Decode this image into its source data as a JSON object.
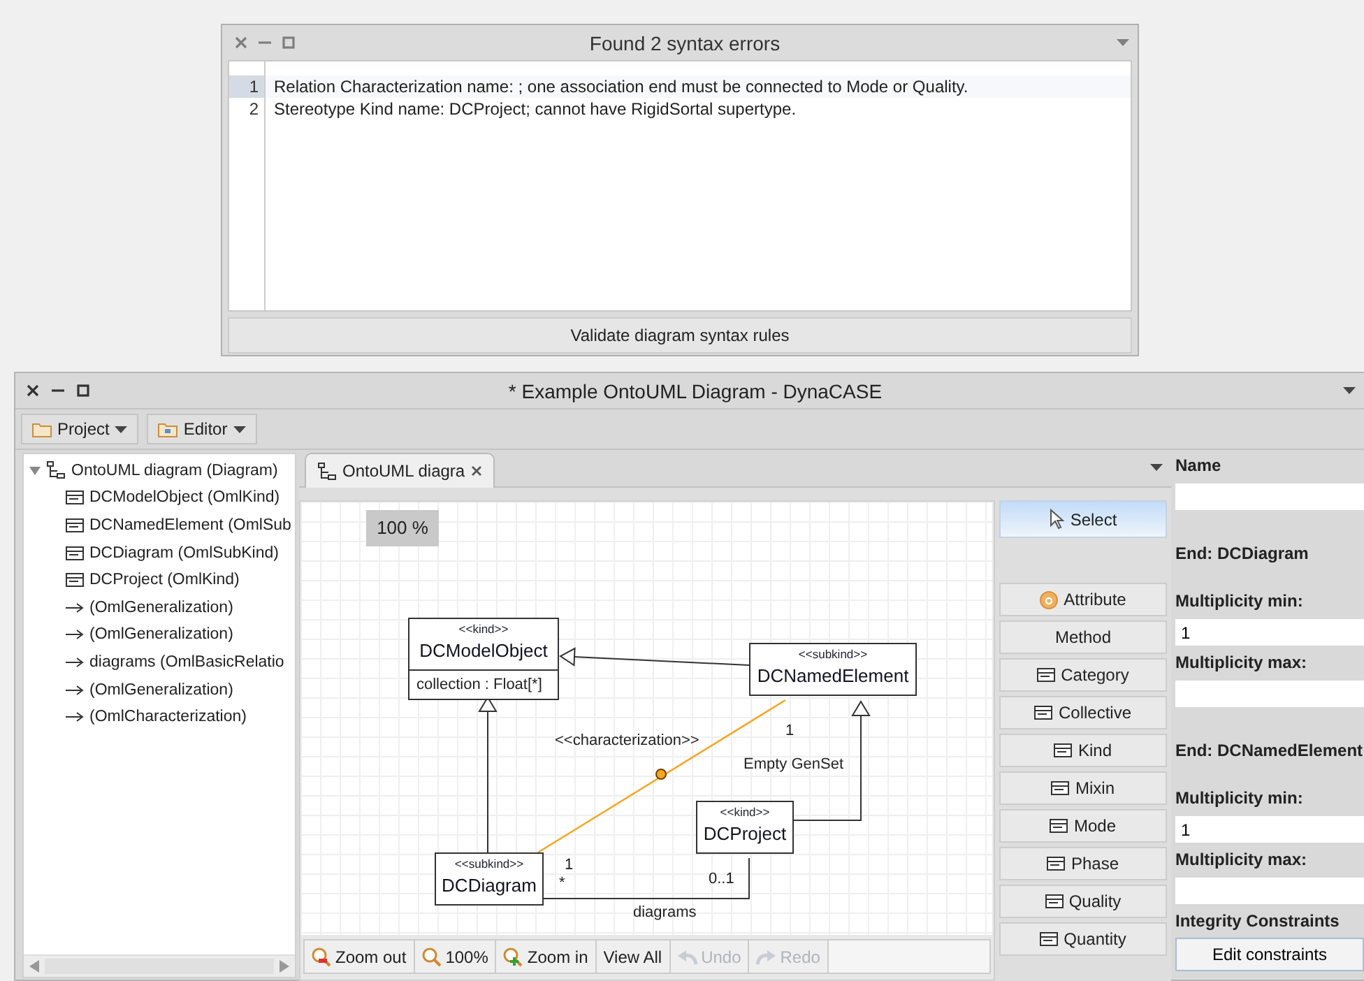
{
  "dialog": {
    "title": "Found 2 syntax errors",
    "errors": [
      {
        "line": "1",
        "text": "Relation Characterization name: ; one association end must be connected to Mode or Quality.",
        "selected": true
      },
      {
        "line": "2",
        "text": "Stereotype Kind name: DCProject; cannot have RigidSortal supertype.",
        "selected": false
      }
    ],
    "button": "Validate diagram syntax rules"
  },
  "window": {
    "title": "* Example OntoUML Diagram - DynaCASE"
  },
  "menus": [
    {
      "label": "Project",
      "kind": "folder"
    },
    {
      "label": "Editor",
      "kind": "editor"
    }
  ],
  "tree": {
    "label": "OntoUML diagram (Diagram)",
    "expanded": true,
    "children": [
      {
        "label": "DCModelObject (OmlKind)",
        "kind": "class"
      },
      {
        "label": "DCNamedElement (OmlSub",
        "kind": "class"
      },
      {
        "label": "DCDiagram (OmlSubKind)",
        "kind": "class"
      },
      {
        "label": "DCProject (OmlKind)",
        "kind": "class"
      },
      {
        "label": "(OmlGeneralization)",
        "kind": "relation"
      },
      {
        "label": "(OmlGeneralization)",
        "kind": "relation"
      },
      {
        "label": "diagrams (OmlBasicRelatio",
        "kind": "relation"
      },
      {
        "label": "(OmlGeneralization)",
        "kind": "relation"
      },
      {
        "label": "(OmlCharacterization)",
        "kind": "relation"
      }
    ]
  },
  "tab": {
    "label": "OntoUML diagra"
  },
  "zoom": "100 %",
  "diagram": {
    "classes": [
      {
        "stereotype": "<<kind>>",
        "name": "DCModelObject",
        "attributes": [
          "collection : Float[*]"
        ]
      },
      {
        "stereotype": "<<subkind>>",
        "name": "DCNamedElement"
      },
      {
        "stereotype": "<<kind>>",
        "name": "DCProject"
      },
      {
        "stereotype": "<<subkind>>",
        "name": "DCDiagram"
      }
    ],
    "relations": [
      {
        "kind": "generalization"
      },
      {
        "kind": "generalization"
      },
      {
        "kind": "generalization",
        "label": "Empty GenSet"
      },
      {
        "kind": "characterization",
        "stereotype": "<<characterization>>",
        "from_mult": "1",
        "to_mult": "1"
      },
      {
        "kind": "association",
        "name": "diagrams",
        "from_mult": "*",
        "to_mult": "0..1"
      }
    ]
  },
  "canvas_tools": [
    {
      "label": "Zoom out",
      "kind": "zoom-out",
      "disabled": false
    },
    {
      "label": "100%",
      "kind": "zoom",
      "disabled": false
    },
    {
      "label": "Zoom in",
      "kind": "zoom-in",
      "disabled": false
    },
    {
      "label": "View All",
      "kind": "text",
      "disabled": false
    },
    {
      "label": "Undo",
      "kind": "undo",
      "disabled": true
    },
    {
      "label": "Redo",
      "kind": "redo",
      "disabled": true
    }
  ],
  "palette": [
    {
      "label": "Select",
      "kind": "pointer",
      "selected": true
    },
    {
      "label": "Attribute",
      "kind": "attribute",
      "selected": false
    },
    {
      "label": "Method",
      "kind": "text",
      "selected": false
    },
    {
      "label": "Category",
      "kind": "class",
      "selected": false
    },
    {
      "label": "Collective",
      "kind": "class",
      "selected": false
    },
    {
      "label": "Kind",
      "kind": "class",
      "selected": false
    },
    {
      "label": "Mixin",
      "kind": "class",
      "selected": false
    },
    {
      "label": "Mode",
      "kind": "class",
      "selected": false
    },
    {
      "label": "Phase",
      "kind": "class",
      "selected": false
    },
    {
      "label": "Quality",
      "kind": "class",
      "selected": false
    },
    {
      "label": "Quantity",
      "kind": "class",
      "selected": false
    }
  ],
  "properties": [
    {
      "kind": "label",
      "text": "Name"
    },
    {
      "kind": "field"
    },
    {
      "kind": "heading",
      "text": "End: DCDiagram"
    },
    {
      "kind": "label",
      "text": "Multiplicity min:"
    },
    {
      "kind": "field",
      "value": "1"
    },
    {
      "kind": "label",
      "text": "Multiplicity max:"
    },
    {
      "kind": "field"
    },
    {
      "kind": "heading",
      "text": "End: DCNamedElement"
    },
    {
      "kind": "label",
      "text": "Multiplicity min:"
    },
    {
      "kind": "field",
      "value": "1"
    },
    {
      "kind": "label",
      "text": "Multiplicity max:"
    },
    {
      "kind": "field"
    },
    {
      "kind": "label",
      "text": "Integrity Constraints"
    },
    {
      "kind": "button",
      "text": "Edit constraints"
    }
  ]
}
